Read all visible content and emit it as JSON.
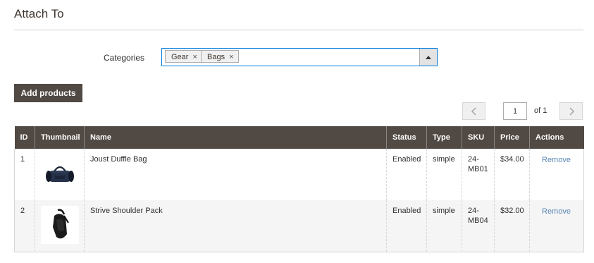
{
  "section": {
    "title": "Attach To"
  },
  "categories": {
    "label": "Categories",
    "chips": [
      {
        "label": "Gear",
        "remove": "×"
      },
      {
        "label": "Bags",
        "remove": "×"
      }
    ]
  },
  "add_button": {
    "label": "Add products"
  },
  "pagination": {
    "current": "1",
    "of_text": "of 1",
    "prev_icon": "‹",
    "next_icon": "›"
  },
  "table": {
    "headers": [
      "ID",
      "Thumbnail",
      "Name",
      "Status",
      "Type",
      "SKU",
      "Price",
      "Actions"
    ],
    "rows": [
      {
        "id": "1",
        "thumb": "duffle-bag-icon",
        "name": "Joust Duffle Bag",
        "status": "Enabled",
        "type": "simple",
        "sku_line1": "24-",
        "sku_line2": "MB01",
        "price": "$34.00",
        "action": "Remove"
      },
      {
        "id": "2",
        "thumb": "shoulder-pack-icon",
        "name": "Strive Shoulder Pack",
        "status": "Enabled",
        "type": "simple",
        "sku_line1": "24-",
        "sku_line2": "MB04",
        "price": "$32.00",
        "action": "Remove"
      }
    ]
  }
}
